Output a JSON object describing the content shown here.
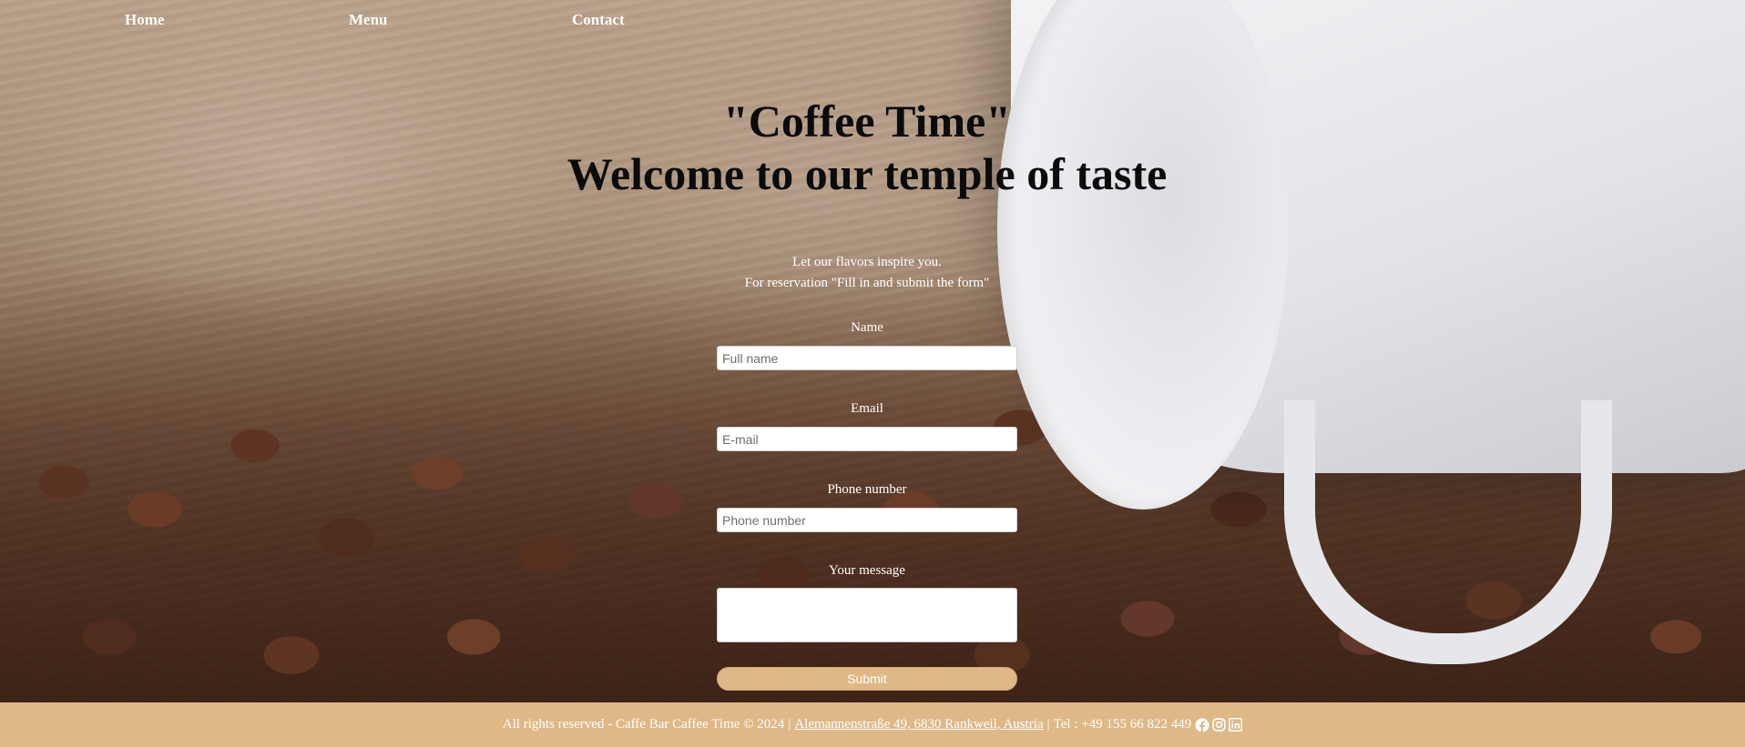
{
  "nav": {
    "home": "Home",
    "menu": "Menu",
    "contact": "Contact"
  },
  "hero": {
    "title_line1": "\"Coffee Time\"",
    "title_line2": "Welcome to our temple of taste"
  },
  "intro": {
    "line1": "Let our flavors inspire you.",
    "line2": "For reservation \"Fill in and submit the form\""
  },
  "form": {
    "name_label": "Name",
    "name_placeholder": "Full name",
    "email_label": "Email",
    "email_placeholder": "E-mail",
    "phone_label": "Phone number",
    "phone_placeholder": "Phone number",
    "message_label": "Your message",
    "message_value": "",
    "submit_label": "Submit"
  },
  "footer": {
    "rights": "All rights reserved - Caffe Bar Caffee Time © 2024",
    "divider1": "|",
    "address": "Alemannenstraße 49, 6830 Rankweil, Austria",
    "divider2": "|",
    "phone": "Tel : +49 155 66 822 449",
    "social_icons": [
      "facebook-icon",
      "instagram-icon",
      "linkedin-icon"
    ]
  },
  "colors": {
    "accent": "#deb887",
    "heading": "#0b0b0b",
    "text_light": "#ffffff"
  }
}
